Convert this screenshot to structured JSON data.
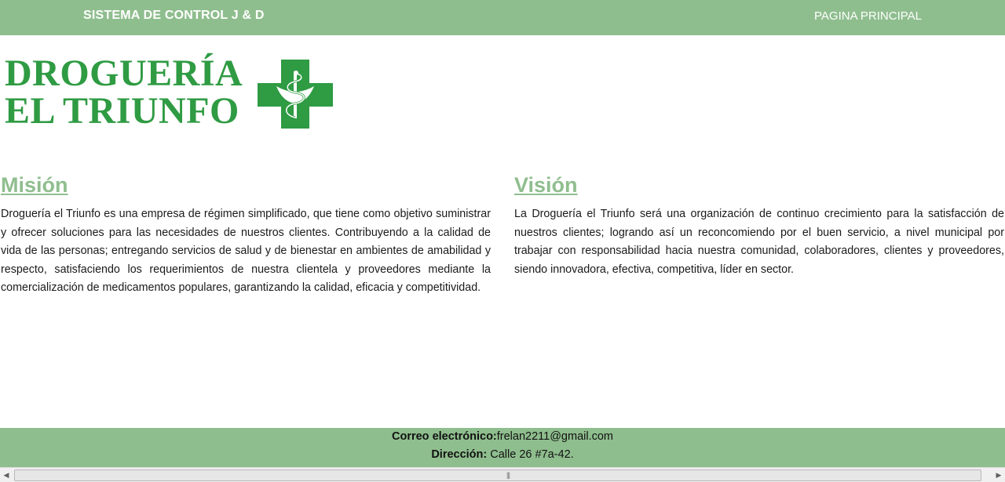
{
  "header": {
    "brand": "SISTEMA DE CONTROL J & D",
    "nav_link": "PAGINA PRINCIPAL"
  },
  "logo": {
    "line1": "DROGUERÍA",
    "line2": "EL TRIUNFO",
    "icon": "pharmacy-cross-icon",
    "color": "#2f9b43"
  },
  "mision": {
    "title": "Misión",
    "text": "Droguería el Triunfo es una empresa de régimen simplificado, que tiene como objetivo suministrar y ofrecer soluciones para las necesidades de nuestros clientes. Contribuyendo a la calidad de vida de las personas; entregando servicios de salud y de bienestar en ambientes de amabilidad y respecto, satisfaciendo los requerimientos de nuestra clientela y proveedores mediante la comercialización de medicamentos populares, garantizando la calidad, eficacia y competitividad."
  },
  "vision": {
    "title": "Visión",
    "text": "La Droguería el Triunfo será una organización de continuo crecimiento para la satisfacción de nuestros clientes; logrando así un reconcomiendo por el buen servicio, a nivel municipal por trabajar con responsabilidad hacia nuestra comunidad, colaboradores, clientes y proveedores, siendo innovadora, efectiva, competitiva, líder en sector."
  },
  "footer": {
    "email_label": "Correo electrónico:",
    "email_value": "frelan2211@gmail.com",
    "address_label": "Dirección:",
    "address_value": " Calle 26 #7a-42."
  },
  "colors": {
    "accent": "#8fbe8e",
    "logo_green": "#2f9b43"
  }
}
